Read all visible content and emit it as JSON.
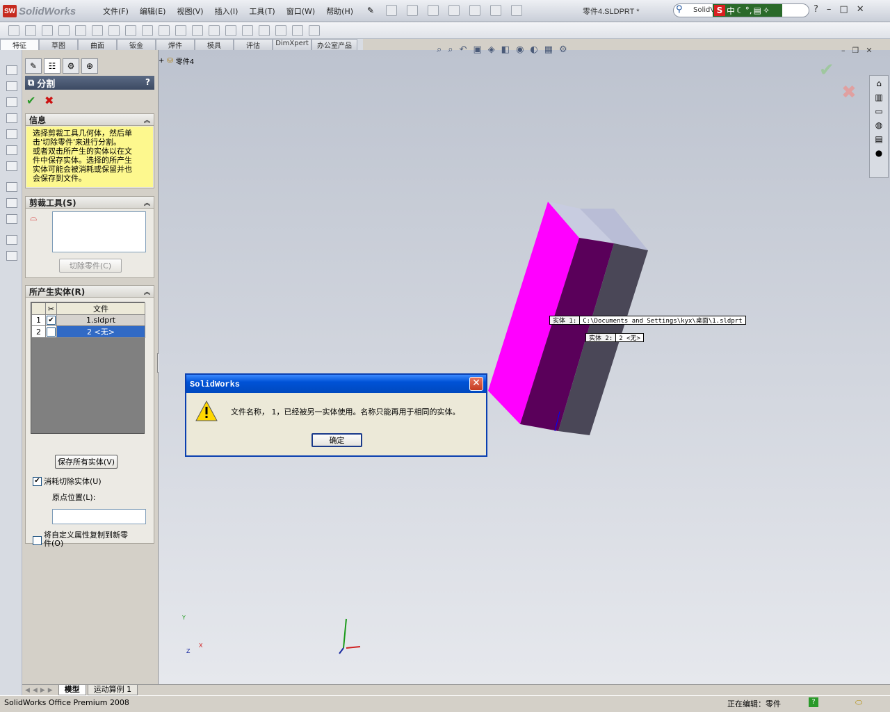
{
  "app": {
    "name": "SolidWorks",
    "logo_mark": "SW"
  },
  "menu": [
    "文件(F)",
    "编辑(E)",
    "视图(V)",
    "插入(I)",
    "工具(T)",
    "窗口(W)",
    "帮助(H)"
  ],
  "document_title": "零件4.SLDPRT *",
  "search": {
    "value": "SolidV"
  },
  "ime": {
    "mode": "中",
    "logo": "S"
  },
  "window_controls": {
    "help": "?",
    "minimize": "–",
    "maximize": "□",
    "close": "✕"
  },
  "command_tabs": [
    "特征",
    "草图",
    "曲面",
    "钣金",
    "焊件",
    "模具",
    "评估",
    "DimXpert",
    "办公室产品"
  ],
  "feature_tree": {
    "expander": "+",
    "root": "零件4"
  },
  "property_manager": {
    "title": "分割",
    "help": "?",
    "ok": "✔",
    "cancel": "✖",
    "info": {
      "header": "信息",
      "text_lines": [
        "选择剪裁工具几何体，然后单",
        "击'切除零件'来进行分割。",
        "或者双击所产生的实体以在文",
        "件中保存实体。选择的所产生",
        "实体可能会被消耗或保留并也",
        "会保存到文件。"
      ]
    },
    "trim_tools": {
      "header": "剪裁工具(S)",
      "cut_button": "切除零件(C)"
    },
    "resulting_bodies": {
      "header": "所产生实体(R)",
      "column_file": "文件",
      "rows": [
        {
          "index": "1",
          "checked": true,
          "file": "1.sldprt",
          "selected": false
        },
        {
          "index": "2",
          "checked": false,
          "file": "2 <无>",
          "selected": true
        }
      ],
      "save_all_button": "保存所有实体(V)"
    },
    "consume_cut_bodies": {
      "label": "消耗切除实体(U)",
      "checked": true
    },
    "origin_location": {
      "label": "原点位置(L):",
      "value": ""
    },
    "copy_custom_props": {
      "label_line1": "将自定义属性复制到新零",
      "label_line2": "件(O)",
      "checked": false
    }
  },
  "callouts": [
    {
      "label": "实体  1:",
      "value": "C:\\Documents and Settings\\kyx\\桌面\\1.sldprt"
    },
    {
      "label": "实体  2:",
      "value": "2 <无>"
    }
  ],
  "dialog": {
    "title": "SolidWorks",
    "message": "文件名称，  1，已经被另一实体使用。名称只能再用于相同的实体。",
    "ok_button": "确定",
    "close": "✕"
  },
  "triad": {
    "x": "X",
    "y": "Y",
    "z": "Z"
  },
  "bottom_tabs": [
    "模型",
    "运动算例 1"
  ],
  "status": {
    "left": "SolidWorks Office Premium 2008",
    "editing": "正在编辑：零件",
    "help": "?"
  },
  "colors": {
    "body_face_front": "#ff00ff",
    "body_face_side": "#5a005a",
    "body_cut": "#4a4757",
    "body_top": "#c8cce0",
    "accept": "#2a9a2a",
    "reject": "#cc1111",
    "info_bg": "#fdf88e"
  }
}
